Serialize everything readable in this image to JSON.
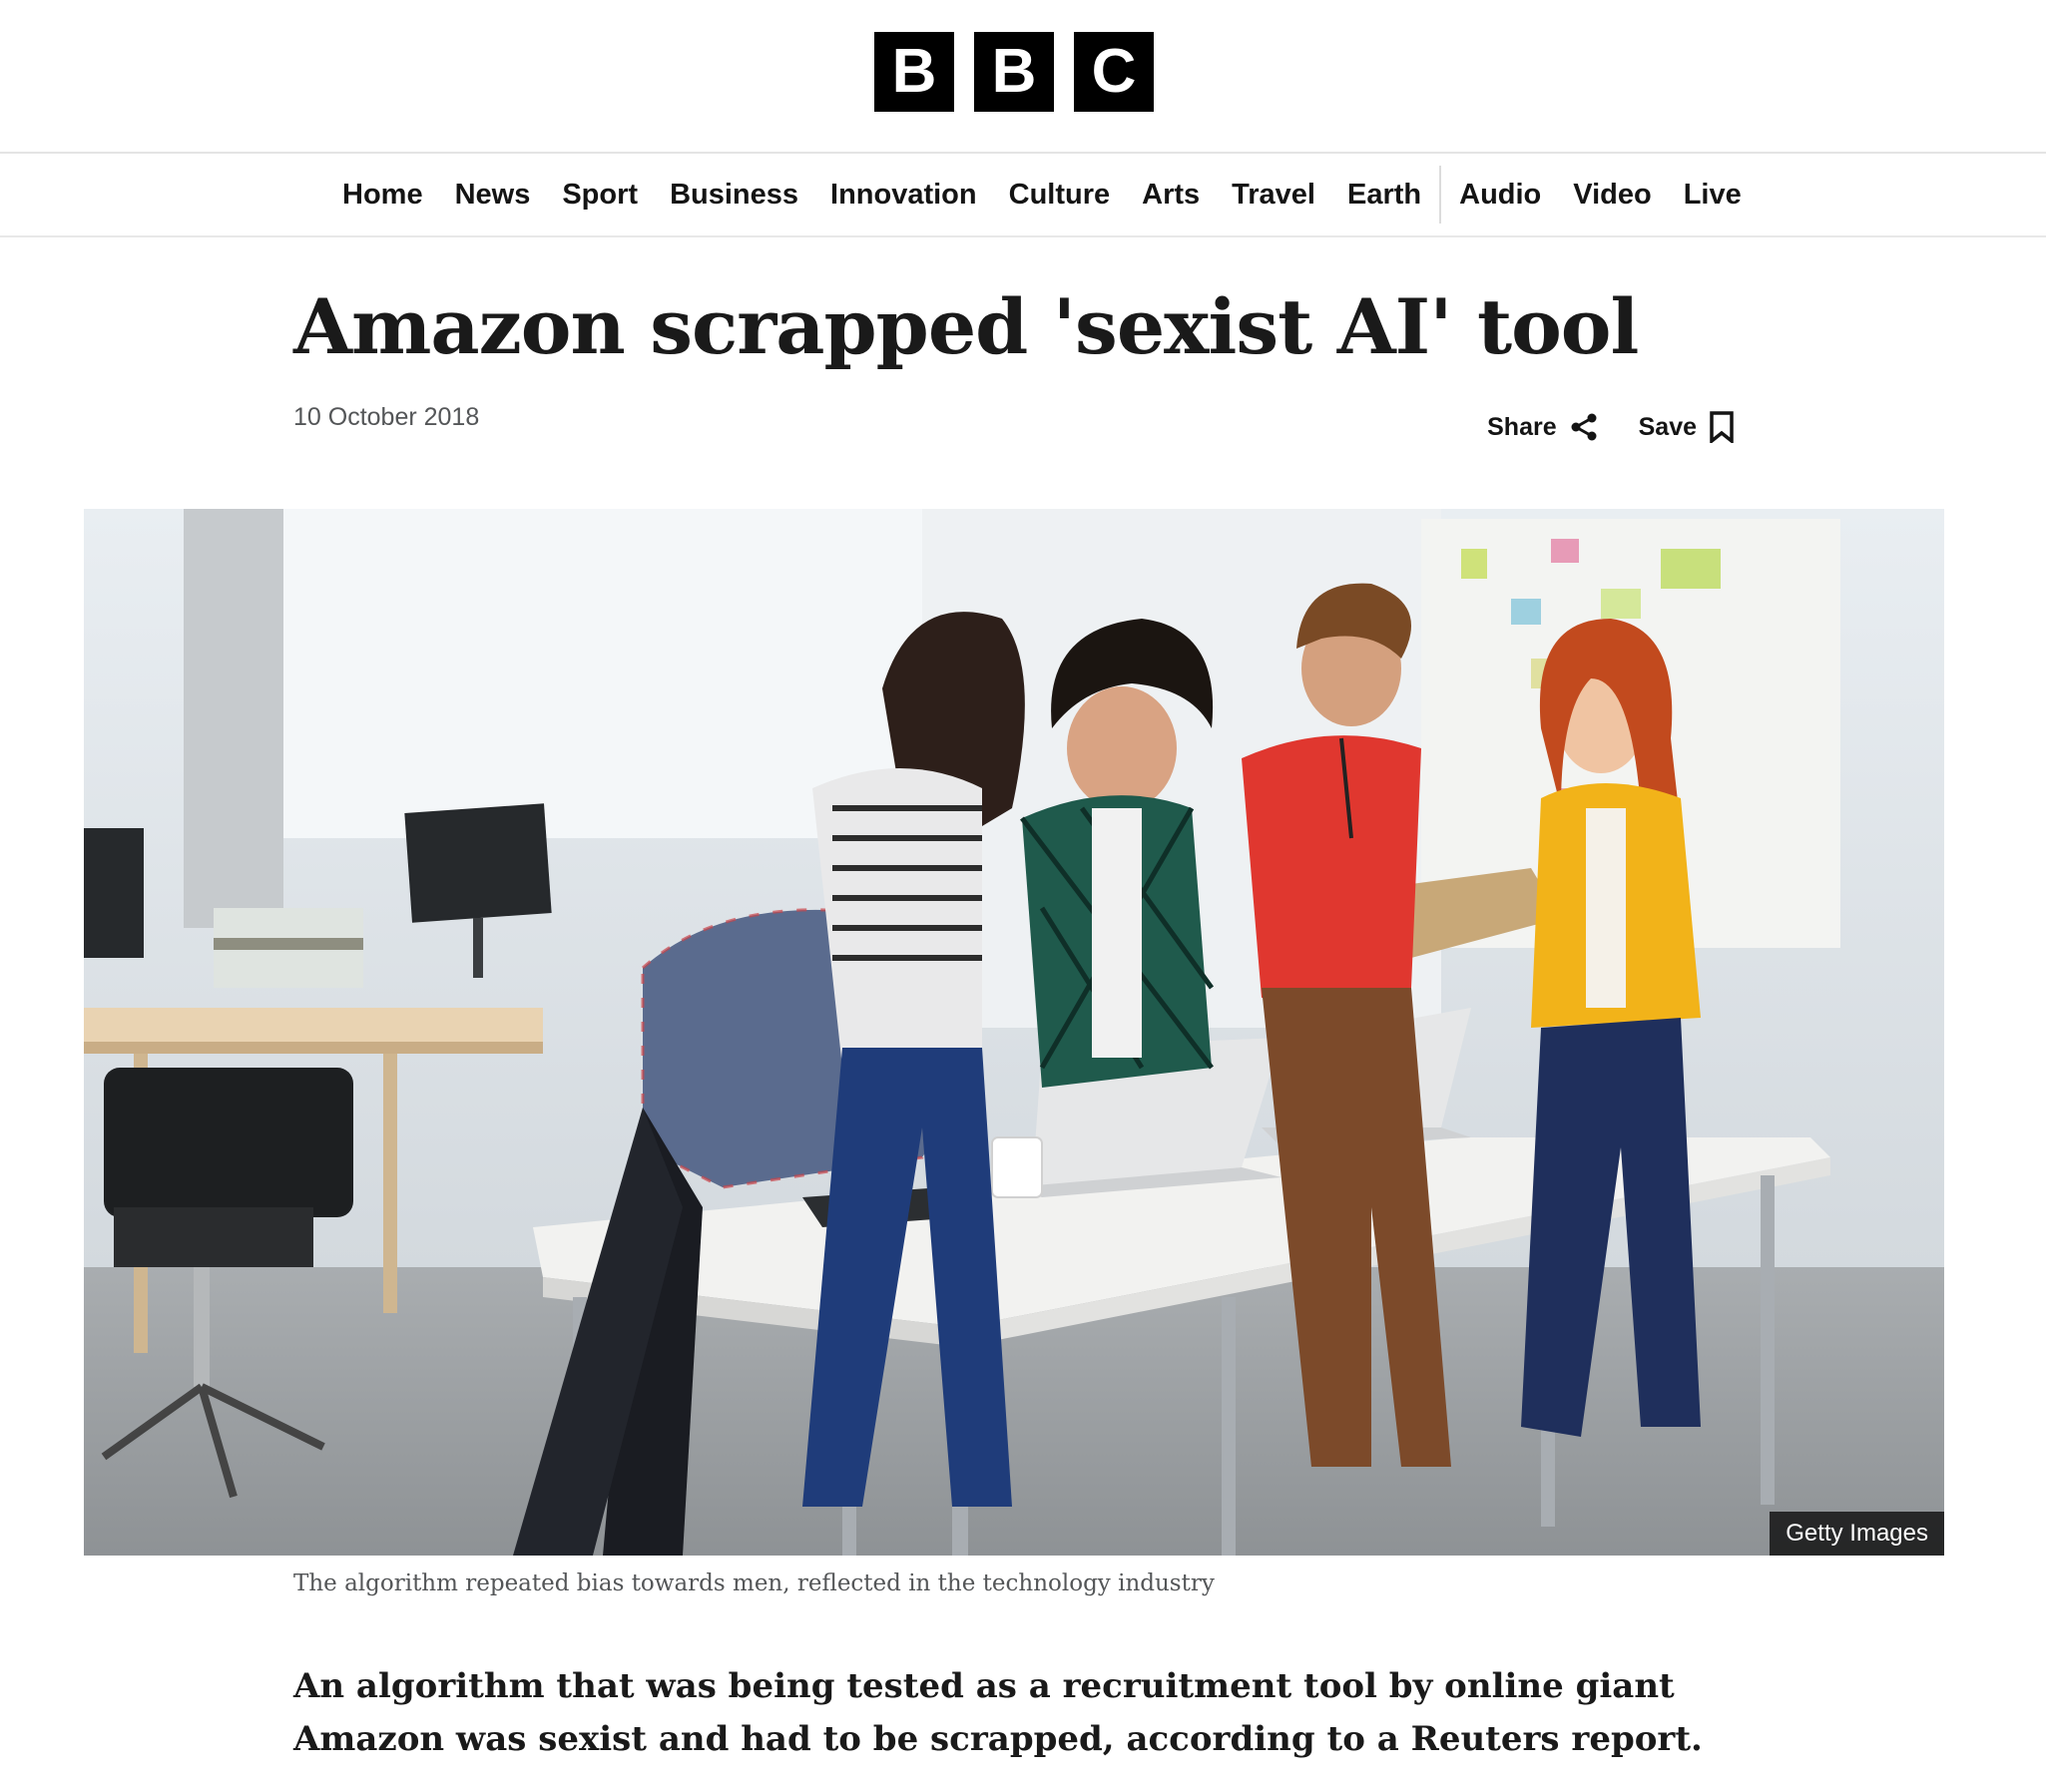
{
  "logo": {
    "letters": [
      "B",
      "B",
      "C"
    ]
  },
  "nav": {
    "items": [
      {
        "label": "Home"
      },
      {
        "label": "News"
      },
      {
        "label": "Sport"
      },
      {
        "label": "Business"
      },
      {
        "label": "Innovation"
      },
      {
        "label": "Culture"
      },
      {
        "label": "Arts"
      },
      {
        "label": "Travel"
      },
      {
        "label": "Earth"
      },
      {
        "label": "Audio"
      },
      {
        "label": "Video"
      },
      {
        "label": "Live"
      }
    ]
  },
  "article": {
    "headline": "Amazon scrapped 'sexist AI' tool",
    "date": "10 October 2018",
    "share_label": "Share",
    "save_label": "Save",
    "image_credit": "Getty Images",
    "image_caption": "The algorithm repeated bias towards men, reflected in the technology industry",
    "lead": "An algorithm that was being tested as a recruitment tool by online giant Amazon was sexist and had to be scrapped, according to a Reuters report."
  },
  "icons": {
    "share": "share-icon",
    "save": "bookmark-icon"
  },
  "colors": {
    "brand_black": "#000000",
    "text": "#141414",
    "muted": "#545658"
  }
}
